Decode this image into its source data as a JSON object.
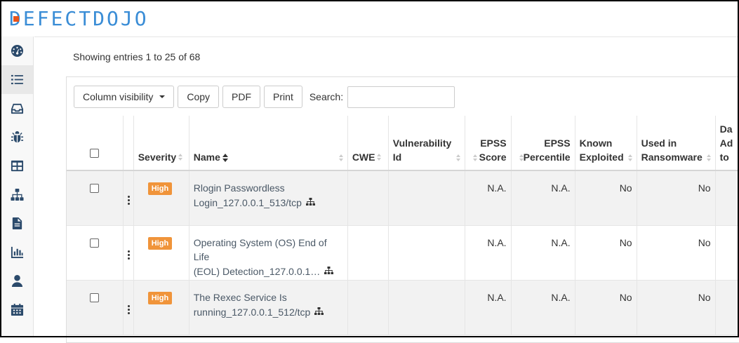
{
  "app": {
    "logo_text": "DEFECTDOJO"
  },
  "sidebar": {
    "items": [
      {
        "icon": "dashboard-icon",
        "active": false
      },
      {
        "icon": "list-icon",
        "active": true
      },
      {
        "icon": "inbox-icon",
        "active": false
      },
      {
        "icon": "bug-icon",
        "active": false
      },
      {
        "icon": "table-icon",
        "active": false
      },
      {
        "icon": "sitemap-icon",
        "active": false
      },
      {
        "icon": "document-icon",
        "active": false
      },
      {
        "icon": "bar-chart-icon",
        "active": false
      },
      {
        "icon": "user-icon",
        "active": false
      },
      {
        "icon": "calendar-icon",
        "active": false
      }
    ]
  },
  "main": {
    "entries_info": "Showing entries 1 to 25 of 68",
    "toolbar": {
      "column_visibility": "Column visibility",
      "copy": "Copy",
      "pdf": "PDF",
      "print": "Print",
      "search_label": "Search:",
      "search_value": ""
    },
    "table": {
      "headers": {
        "severity": "Severity",
        "name": "Name",
        "cwe": "CWE",
        "vuln_id_1": "Vulnerability",
        "vuln_id_2": "Id",
        "epss_score_1": "EPSS",
        "epss_score_2": "Score",
        "epss_pct_1": "EPSS",
        "epss_pct_2": "Percentile",
        "known_exploited_1": "Known",
        "known_exploited_2": "Exploited",
        "ransomware_1": "Used in",
        "ransomware_2": "Ransomware",
        "date_added_1": "Da",
        "date_added_2": "Ad",
        "date_added_3": "to"
      },
      "rows": [
        {
          "severity": "High",
          "name_1": "Rlogin Passwordless",
          "name_2": "Login_127.0.0.1_513/tcp",
          "cwe": "",
          "vuln_id": "",
          "epss_score": "N.A.",
          "epss_percentile": "N.A.",
          "known_exploited": "No",
          "ransomware": "No"
        },
        {
          "severity": "High",
          "name_1": "Operating System (OS) End of Life",
          "name_2": "(EOL) Detection_127.0.0.1…",
          "cwe": "",
          "vuln_id": "",
          "epss_score": "N.A.",
          "epss_percentile": "N.A.",
          "known_exploited": "No",
          "ransomware": "No"
        },
        {
          "severity": "High",
          "name_1": "The Rexec Service Is",
          "name_2": "running_127.0.0.1_512/tcp",
          "cwe": "",
          "vuln_id": "",
          "epss_score": "N.A.",
          "epss_percentile": "N.A.",
          "known_exploited": "No",
          "ransomware": "No"
        }
      ]
    }
  },
  "colors": {
    "logo_blue": "#3a8dd6",
    "logo_orange": "#e8541b",
    "severity_high": "#f0943a",
    "sidebar_icon": "#2b4a6b"
  }
}
